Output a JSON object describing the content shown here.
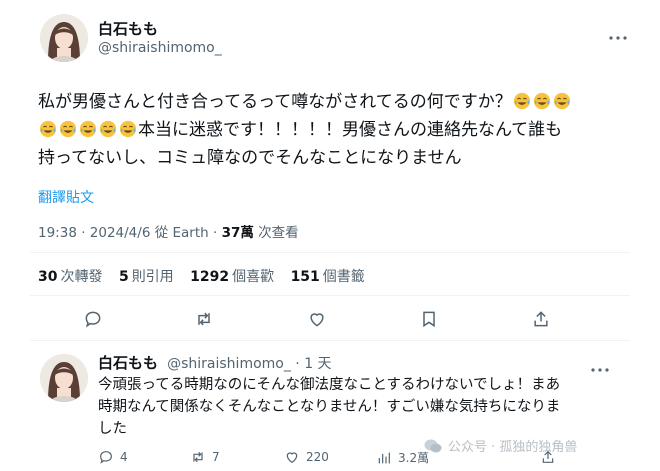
{
  "tweet": {
    "author_name": "白石もも",
    "author_handle": "@shiraishimomo_",
    "text_line1": "私が男優さんと付き合ってるって噂ながされてるの何ですか？",
    "text_line2_after_emoji": "本当に迷惑です！！！！！男優さんの連絡先なんて誰も",
    "text_line3": "持ってないし、コミュ障なのでそんなことになりません",
    "translate_label": "翻譯貼文",
    "time": "19:38 · 2024/4/6 從 Earth · ",
    "views_count": "37萬",
    "views_label": " 次查看",
    "emoji_name": "face-with-tears-of-joy"
  },
  "stats": {
    "retweets_count": "30",
    "retweets_label": "次轉發",
    "quotes_count": "5",
    "quotes_label": "則引用",
    "likes_count": "1292",
    "likes_label": "個喜歡",
    "bookmarks_count": "151",
    "bookmarks_label": "個書籤"
  },
  "actions": [
    "reply-icon",
    "retweet-icon",
    "like-icon",
    "bookmark-icon",
    "share-icon"
  ],
  "reply": {
    "author_name": "白石もも",
    "handle_time": "@shiraishimomo_ · 1 天",
    "text_line1": "今頑張ってる時期なのにそんな御法度なことするわけないでしょ！まあ",
    "text_line2": "時期なんて関係なくそんなことなりません！すごい嫌な気持ちになりま",
    "text_line3": "した",
    "replies": "4",
    "retweets": "7",
    "likes": "220",
    "views": "3.2萬"
  },
  "watermark": {
    "text": "公众号 · 孤独的独角兽"
  },
  "colors": {
    "accent": "#1d9bf0",
    "muted": "#536471",
    "divider": "#eff3f4"
  }
}
